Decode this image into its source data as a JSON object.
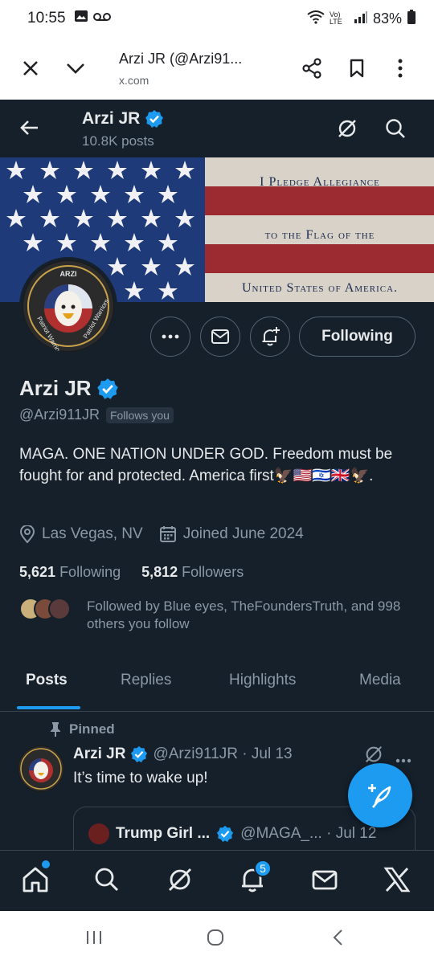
{
  "status_bar": {
    "time": "10:55",
    "lte": "Vo) LTE",
    "battery": "83%"
  },
  "custom_tab": {
    "title": "Arzi JR (@Arzi91...",
    "url": "x.com"
  },
  "header": {
    "name": "Arzi JR",
    "posts": "10.8K posts"
  },
  "banner": {
    "line1": "I Pledge Allegiance",
    "line2": "to the Flag of the",
    "line3": "United States of America."
  },
  "avatar": {
    "top": "ARZI",
    "ring1": "Patriot Warriors",
    "ring2": "Patriot Warriors"
  },
  "profile": {
    "following_button": "Following",
    "name": "Arzi JR",
    "handle": "@Arzi911JR",
    "follows_you": "Follows you",
    "bio": "MAGA. ONE NATION UNDER GOD. Freedom must be fought for and protected. America first🦅🇺🇸🇮🇱🇬🇧🦅.",
    "location": "Las Vegas, NV",
    "joined": "Joined June 2024",
    "following_count": "5,621",
    "following_label": "Following",
    "followers_count": "5,812",
    "followers_label": "Followers",
    "followed_by": "Followed by Blue eyes, TheFoundersTruth, and 998 others you follow"
  },
  "tabs": [
    "Posts",
    "Replies",
    "Highlights",
    "Media"
  ],
  "post": {
    "pinned_label": "Pinned",
    "name": "Arzi JR",
    "handle_date": "@Arzi911JR · Jul 13",
    "text": "It’s time to wake up!",
    "quote_name": "Trump Girl ...",
    "quote_handle_date": "@MAGA_... · Jul 12"
  },
  "nav": {
    "notifications_badge": "5"
  },
  "colors": {
    "background": "#15202b",
    "accent": "#1d9bf0",
    "verified": "#1d9bf0"
  }
}
